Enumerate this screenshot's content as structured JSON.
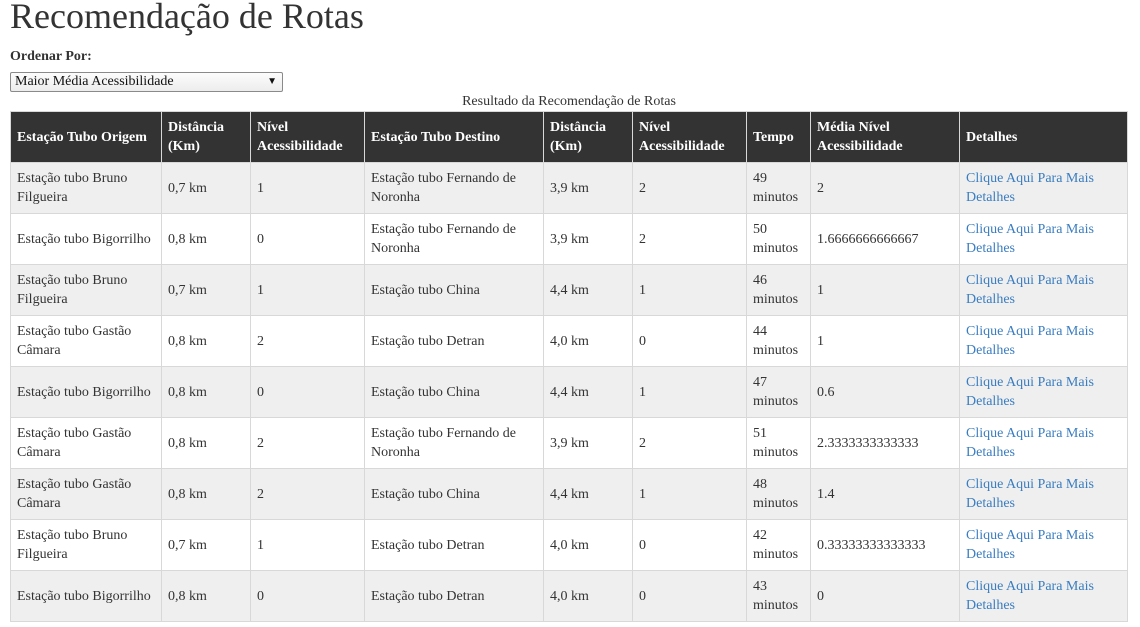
{
  "page": {
    "title": "Recomendação de Rotas",
    "sort_label": "Ordenar Por:",
    "sort_selected": "Maior Média Acessibilidade"
  },
  "icons": {
    "select_arrow": "chevron-down-icon"
  },
  "colors": {
    "header_bg": "#333333",
    "row_alt_bg": "#efefef",
    "link": "#3a7dc1"
  },
  "table": {
    "caption": "Resultado da Recomendação de Rotas",
    "columns": [
      "Estação Tubo Origem",
      "Distância (Km)",
      "Nível Acessibilidade",
      "Estação Tubo Destino",
      "Distância (Km)",
      "Nível Acessibilidade",
      "Tempo",
      "Média Nível Acessibilidade",
      "Detalhes"
    ],
    "rows": [
      [
        "Estação tubo Bruno Filgueira",
        "0,7 km",
        "1",
        "Estação tubo Fernando de Noronha",
        "3,9 km",
        "2",
        "49 minutos",
        "2",
        "Clique Aqui Para Mais Detalhes"
      ],
      [
        "Estação tubo Bigorrilho",
        "0,8 km",
        "0",
        "Estação tubo Fernando de Noronha",
        "3,9 km",
        "2",
        "50 minutos",
        "1.6666666666667",
        "Clique Aqui Para Mais Detalhes"
      ],
      [
        "Estação tubo Bruno Filgueira",
        "0,7 km",
        "1",
        "Estação tubo China",
        "4,4 km",
        "1",
        "46 minutos",
        "1",
        "Clique Aqui Para Mais Detalhes"
      ],
      [
        "Estação tubo Gastão Câmara",
        "0,8 km",
        "2",
        "Estação tubo Detran",
        "4,0 km",
        "0",
        "44 minutos",
        "1",
        "Clique Aqui Para Mais Detalhes"
      ],
      [
        "Estação tubo Bigorrilho",
        "0,8 km",
        "0",
        "Estação tubo China",
        "4,4 km",
        "1",
        "47 minutos",
        "0.6",
        "Clique Aqui Para Mais Detalhes"
      ],
      [
        "Estação tubo Gastão Câmara",
        "0,8 km",
        "2",
        "Estação tubo Fernando de Noronha",
        "3,9 km",
        "2",
        "51 minutos",
        "2.3333333333333",
        "Clique Aqui Para Mais Detalhes"
      ],
      [
        "Estação tubo Gastão Câmara",
        "0,8 km",
        "2",
        "Estação tubo China",
        "4,4 km",
        "1",
        "48 minutos",
        "1.4",
        "Clique Aqui Para Mais Detalhes"
      ],
      [
        "Estação tubo Bruno Filgueira",
        "0,7 km",
        "1",
        "Estação tubo Detran",
        "4,0 km",
        "0",
        "42 minutos",
        "0.33333333333333",
        "Clique Aqui Para Mais Detalhes"
      ],
      [
        "Estação tubo Bigorrilho",
        "0,8 km",
        "0",
        "Estação tubo Detran",
        "4,0 km",
        "0",
        "43 minutos",
        "0",
        "Clique Aqui Para Mais Detalhes"
      ]
    ]
  }
}
